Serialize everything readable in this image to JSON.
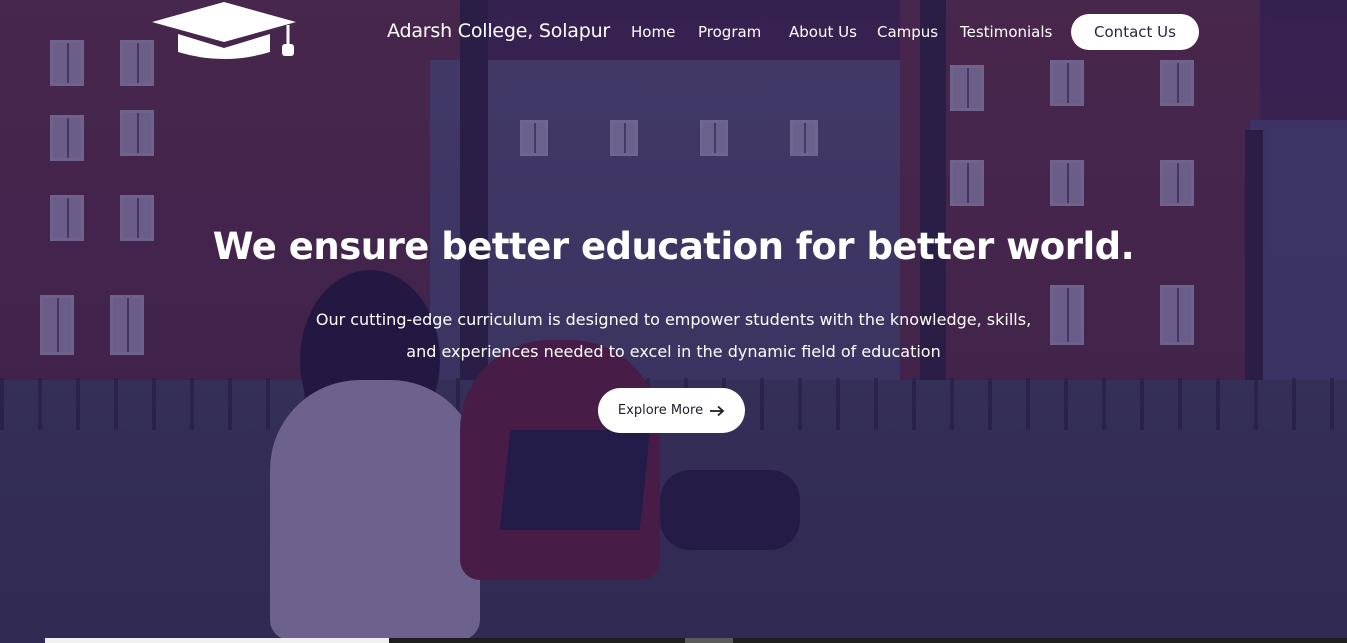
{
  "header": {
    "brand_name": "Adarsh College, Solapur",
    "logo_icon": "graduation-cap-icon",
    "nav_items": [
      {
        "label": "Home"
      },
      {
        "label": "Program"
      },
      {
        "label": "About Us"
      },
      {
        "label": "Campus"
      },
      {
        "label": "Testimonials"
      }
    ],
    "contact_label": "Contact Us"
  },
  "hero": {
    "headline": "We ensure better education for better world.",
    "subtext_line1": "Our cutting-edge curriculum is designed to empower students with the knowledge, skills,",
    "subtext_line2": "and experiences needed to excel in the dynamic field of education",
    "cta_label": "Explore More",
    "cta_icon": "arrow-right-icon",
    "overlay_color": "#281c5c"
  }
}
